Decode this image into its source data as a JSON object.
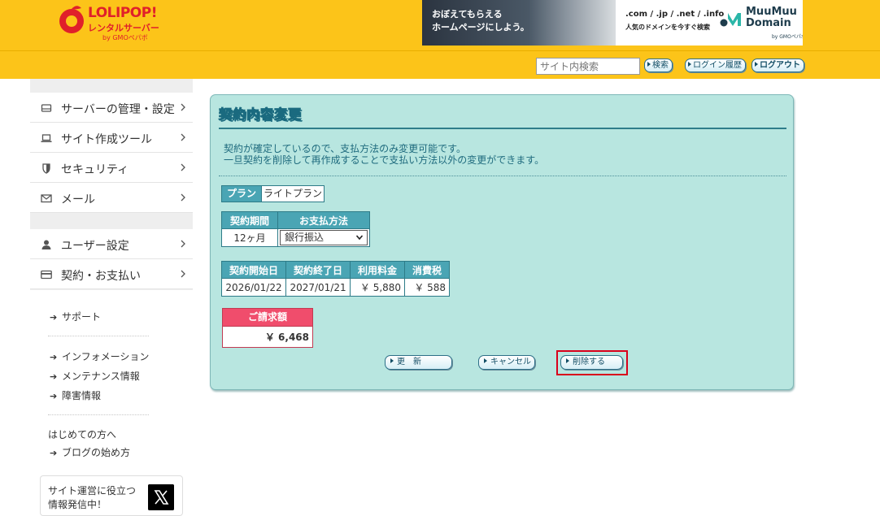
{
  "header": {
    "logo": {
      "main": "LOLIPOP!",
      "sub": "レンタルサーバー",
      "by": "by GMOペパボ"
    },
    "banner": {
      "photo_line1": "おぼえてもらえる",
      "photo_line2": "ホームページにしよう。",
      "domains": ".com / .jp / .net / .info",
      "tagline": "人気のドメインを今すぐ検索",
      "brand_line1": "MuuMuu",
      "brand_line2": "Domain",
      "brand_by": "by GMOペパボ"
    },
    "search_placeholder": "サイト内検索",
    "buttons": {
      "search": "検索",
      "login_history": "ログイン履歴",
      "logout": "ログアウト"
    }
  },
  "sidebar": {
    "menu_top": [
      {
        "label": "サーバーの管理・設定",
        "icon": "server-icon"
      },
      {
        "label": "サイト作成ツール",
        "icon": "laptop-icon"
      },
      {
        "label": "セキュリティ",
        "icon": "shield-icon"
      },
      {
        "label": "メール",
        "icon": "mail-icon"
      }
    ],
    "menu_bottom": [
      {
        "label": "ユーザー設定",
        "icon": "user-icon"
      },
      {
        "label": "契約・お支払い",
        "icon": "card-icon"
      }
    ],
    "support": "サポート",
    "information": "インフォメーション",
    "maintenance": "メンテナンス情報",
    "outage": "障害情報",
    "beginners": "はじめての方へ",
    "blog_start": "ブログの始め方",
    "x_card_line1": "サイト運営に役立つ",
    "x_card_line2": "情報発信中！"
  },
  "panel": {
    "title": "契約内容変更",
    "notice_line1": "契約が確定しているので、支払方法のみ変更可能です。",
    "notice_line2": "一旦契約を削除して再作成することで支払い方法以外の変更ができます。",
    "plan_label": "プラン",
    "plan_value": "ライトプラン",
    "term_table": {
      "headers": [
        "契約期間",
        "お支払方法"
      ],
      "period": "12ヶ月",
      "payment_selected": "銀行振込"
    },
    "date_table": {
      "headers": [
        "契約開始日",
        "契約終了日",
        "利用料金",
        "消費税"
      ],
      "values": [
        "2026/01/22",
        "2027/01/21",
        "￥ 5,880",
        "￥ 588"
      ]
    },
    "bill": {
      "label": "ご請求額",
      "value": "￥ 6,468"
    },
    "buttons": {
      "update": "更　新",
      "cancel": "キャンセル",
      "delete": "削除する"
    }
  },
  "colors": {
    "header_bg": "#fcc419",
    "panel_bg": "#b8e6e0",
    "table_header_bg": "#4aa5b4",
    "bill_header_bg": "#f04d6c",
    "highlight_border": "#d9001b"
  }
}
